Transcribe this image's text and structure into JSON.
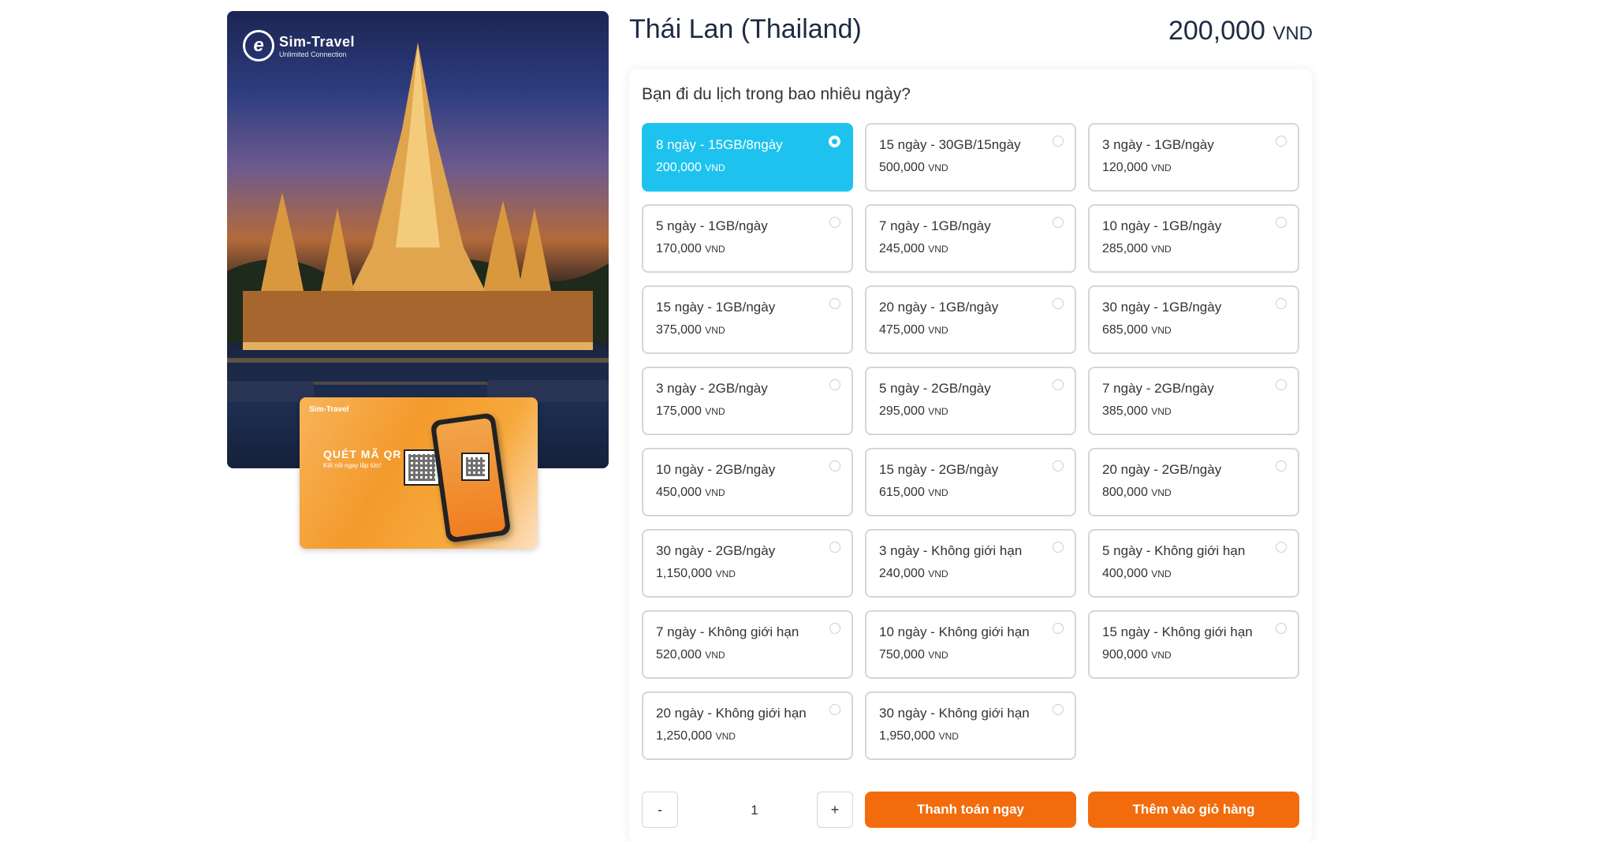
{
  "gallery": {
    "brand_name": "Sim-Travel",
    "brand_tagline": "Unlimited Connection",
    "promo_brand": "Sim-Travel",
    "promo_title": "QUÉT MÃ QR",
    "promo_subtitle": "Kết nối ngay lập tức!"
  },
  "product": {
    "title": "Thái Lan (Thailand)",
    "price_value": "200,000",
    "price_currency": "VND"
  },
  "options_section": {
    "question": "Bạn đi du lịch trong bao nhiêu ngày?",
    "currency": "VND",
    "selected_index": 0,
    "options": [
      {
        "name": "8 ngày - 15GB/8ngày",
        "price": "200,000"
      },
      {
        "name": "15 ngày - 30GB/15ngày",
        "price": "500,000"
      },
      {
        "name": "3 ngày - 1GB/ngày",
        "price": "120,000"
      },
      {
        "name": "5 ngày - 1GB/ngày",
        "price": "170,000"
      },
      {
        "name": "7 ngày - 1GB/ngày",
        "price": "245,000"
      },
      {
        "name": "10 ngày - 1GB/ngày",
        "price": "285,000"
      },
      {
        "name": "15 ngày - 1GB/ngày",
        "price": "375,000"
      },
      {
        "name": "20 ngày - 1GB/ngày",
        "price": "475,000"
      },
      {
        "name": "30 ngày - 1GB/ngày",
        "price": "685,000"
      },
      {
        "name": "3 ngày - 2GB/ngày",
        "price": "175,000"
      },
      {
        "name": "5 ngày - 2GB/ngày",
        "price": "295,000"
      },
      {
        "name": "7 ngày - 2GB/ngày",
        "price": "385,000"
      },
      {
        "name": "10 ngày - 2GB/ngày",
        "price": "450,000"
      },
      {
        "name": "15 ngày - 2GB/ngày",
        "price": "615,000"
      },
      {
        "name": "20 ngày - 2GB/ngày",
        "price": "800,000"
      },
      {
        "name": "30 ngày - 2GB/ngày",
        "price": "1,150,000"
      },
      {
        "name": "3 ngày - Không giới hạn",
        "price": "240,000"
      },
      {
        "name": "5 ngày - Không giới hạn",
        "price": "400,000"
      },
      {
        "name": "7 ngày - Không giới hạn",
        "price": "520,000"
      },
      {
        "name": "10 ngày - Không giới hạn",
        "price": "750,000"
      },
      {
        "name": "15 ngày - Không giới hạn",
        "price": "900,000"
      },
      {
        "name": "20 ngày - Không giới hạn",
        "price": "1,250,000"
      },
      {
        "name": "30 ngày - Không giới hạn",
        "price": "1,950,000"
      }
    ]
  },
  "purchase": {
    "decrement_label": "-",
    "quantity": "1",
    "increment_label": "+",
    "buy_now_label": "Thanh toán ngay",
    "add_to_cart_label": "Thêm vào giỏ hàng"
  }
}
